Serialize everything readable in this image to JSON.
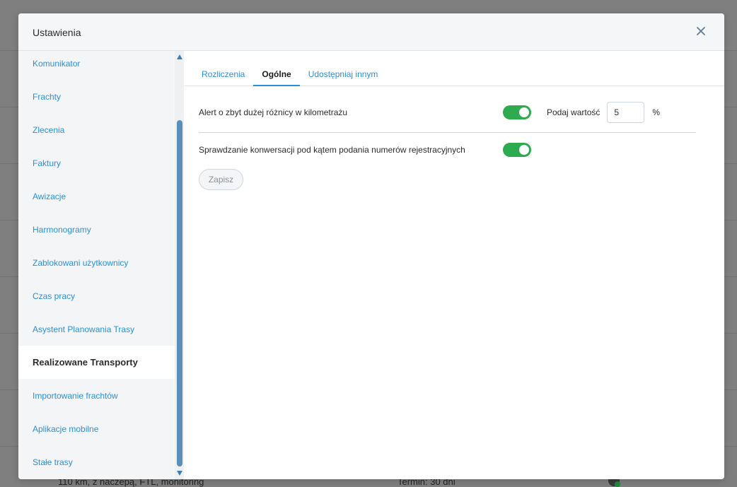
{
  "background": {
    "footer_left": "110 km, z naczepą, FTL, monitoring",
    "footer_right": "Termin: 30 dni"
  },
  "modal": {
    "title": "Ustawienia",
    "close_icon": "close-icon"
  },
  "sidebar": {
    "items": [
      {
        "label": "Komunikator"
      },
      {
        "label": "Frachty"
      },
      {
        "label": "Zlecenia"
      },
      {
        "label": "Faktury"
      },
      {
        "label": "Awizacje"
      },
      {
        "label": "Harmonogramy"
      },
      {
        "label": "Zablokowani użytkownicy"
      },
      {
        "label": "Czas pracy"
      },
      {
        "label": "Asystent Planowania Trasy"
      },
      {
        "label": "Realizowane Transporty"
      },
      {
        "label": "Importowanie frachtów"
      },
      {
        "label": "Aplikacje mobilne"
      },
      {
        "label": "Stałe trasy"
      }
    ],
    "active": "Realizowane Transporty"
  },
  "tabs": [
    {
      "label": "Rozliczenia"
    },
    {
      "label": "Ogólne"
    },
    {
      "label": "Udostępniaj innym"
    }
  ],
  "active_tab": "Ogólne",
  "settings": {
    "distance_alert": {
      "label": "Alert o zbyt dużej różnicy w kilometrażu",
      "enabled": true,
      "value_label": "Podaj wartość",
      "value": "5",
      "unit": "%"
    },
    "plate_check": {
      "label": "Sprawdzanie konwersacji pod kątem podania numerów rejestracyjnych",
      "enabled": true
    }
  },
  "save_button": "Zapisz",
  "colors": {
    "accent": "#2a8fd6",
    "toggle_on": "#2eaa4f",
    "overlay": "#7f7f7f"
  }
}
